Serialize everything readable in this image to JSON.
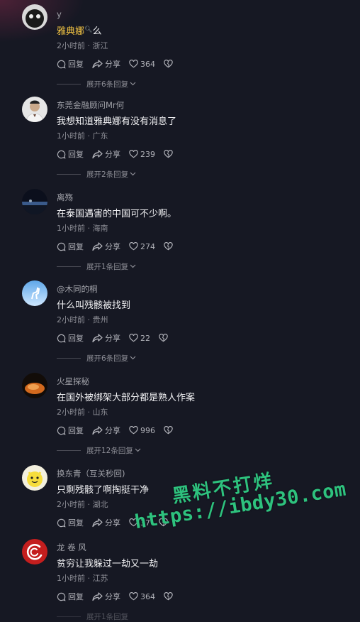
{
  "actions": {
    "reply": "回复",
    "share": "分享"
  },
  "comments": [
    {
      "username": "y",
      "text_highlight": "雅典娜",
      "text_suffix": "么",
      "meta": "2小时前 · 浙江",
      "likes": "364",
      "expand": "展开6条回复"
    },
    {
      "username": "东莞金融顾问Mr何",
      "text": "我想知道雅典娜有没有消息了",
      "meta": "1小时前 · 广东",
      "likes": "239",
      "expand": "展开2条回复"
    },
    {
      "username": "离殇",
      "text": "在泰国遇害的中国可不少啊。",
      "meta": "1小时前 · 海南",
      "likes": "274",
      "expand": "展开1条回复"
    },
    {
      "username": "@木同的桐",
      "text": "什么叫残骸被找到",
      "meta": "2小时前 · 贵州",
      "likes": "22",
      "expand": "展开6条回复"
    },
    {
      "username": "火星探秘",
      "text": "在国外被绑架大部分都是熟人作案",
      "meta": "2小时前 · 山东",
      "likes": "996",
      "expand": "展开12条回复"
    },
    {
      "username": "换东青（互关秒回)",
      "text": "只剩残骸了啊掏挺干净",
      "meta": "2小时前 · 湖北",
      "likes": "37",
      "expand": ""
    },
    {
      "username": "龙 卷 风",
      "text": "贫穷让我躲过一劫又一劫",
      "meta": "1小时前 · 江苏",
      "likes": "364",
      "expand": "展开1条回复"
    }
  ],
  "watermark": {
    "line1": "黑料不打烊",
    "line2": "https://ibdy30.com"
  },
  "colors": {
    "background": "#161823",
    "highlight": "#f7c744",
    "watermark": "#2ec27e"
  }
}
